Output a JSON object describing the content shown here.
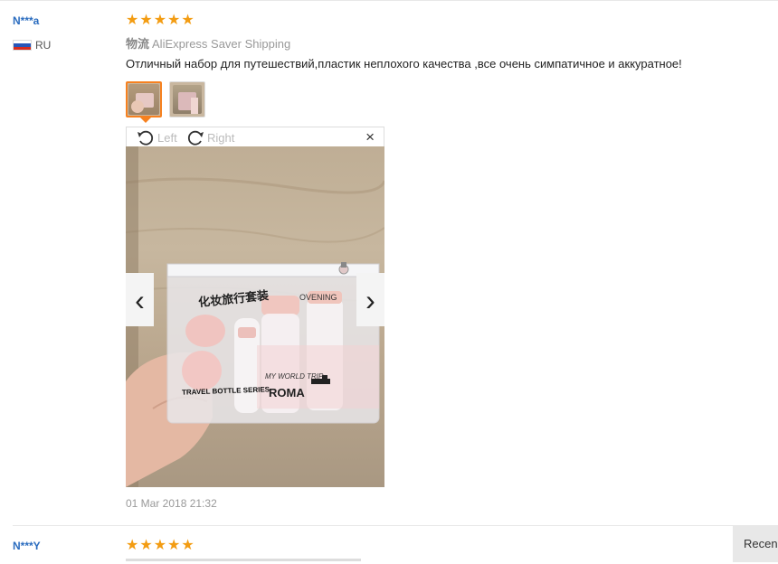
{
  "reviews": [
    {
      "user": "N***a",
      "country": "RU",
      "rating": "★★★★★",
      "shipping_label": "物流",
      "shipping_value": "AliExpress Saver Shipping",
      "text": "Отличный набор для путешествий,пластик неплохого качества ,все очень симпатичное и аккуратное!",
      "date": "01 Mar 2018 21:32"
    },
    {
      "user": "N***Y",
      "rating": "★★★★★"
    }
  ],
  "viewer": {
    "rotate_left": "Left",
    "rotate_right": "Right",
    "close": "×",
    "prev": "‹",
    "next": "›"
  },
  "photo": {
    "bag_title": "化妆旅行套装",
    "badge_text": "TRAVEL BOTTLE SERIES",
    "tagline": "MY WORLD TRIP",
    "city": "ROMA",
    "bottle_label": "OVENING"
  },
  "sidebar_tab": "Recen",
  "colors": {
    "accent": "#f68120",
    "star": "#f39c12",
    "username": "#2a6cbf"
  }
}
